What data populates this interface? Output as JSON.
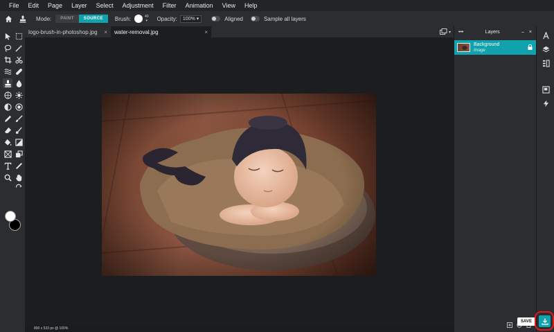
{
  "menu": [
    "File",
    "Edit",
    "Page",
    "Layer",
    "Select",
    "Adjustment",
    "Filter",
    "Animation",
    "View",
    "Help"
  ],
  "options": {
    "mode_label": "Mode:",
    "mode_paint": "PAINT",
    "mode_source": "SOURCE",
    "brush_label": "Brush:",
    "brush_size": "40",
    "opacity_label": "Opacity:",
    "opacity_value": "100% ▾",
    "aligned_label": "Aligned",
    "sample_label": "Sample all layers"
  },
  "tabs": [
    {
      "label": "logo-brush-in-photoshop.jpg",
      "close": "×"
    },
    {
      "label": "water-removal.jpg",
      "close": "×"
    }
  ],
  "status": {
    "text": "800 x 533 px @ 100%"
  },
  "layers_panel": {
    "dots": "•••",
    "title": "Layers",
    "minimize": "–",
    "close": "×",
    "layers": [
      {
        "name": "Background",
        "type": "Image"
      }
    ]
  },
  "buttons": {
    "save": "SAVE"
  },
  "colors": {
    "accent": "#12a2ad",
    "foreground": "#ffffff",
    "background": "#000000",
    "highlight": "#e31b1b"
  },
  "icons": {
    "toolbox": [
      "move-icon",
      "marquee-icon",
      "lasso-icon",
      "magic-wand-icon",
      "crop-icon",
      "scissors-icon",
      "liquify-icon",
      "bandage-icon",
      "clone-stamp-icon",
      "blur-drop-icon",
      "sponge-icon",
      "sharpen-icon",
      "dodge-icon",
      "spot-heal-icon",
      "pencil-icon",
      "brush-icon",
      "eraser-icon",
      "smudge-icon",
      "bucket-icon",
      "gradient-icon",
      "shape-icon",
      "replace-color-icon",
      "text-icon",
      "eyedropper-icon",
      "zoom-icon",
      "hand-icon"
    ],
    "rail": [
      "character-icon",
      "layers-icon",
      "adjustments-icon",
      "navigator-icon",
      "actions-icon"
    ]
  }
}
